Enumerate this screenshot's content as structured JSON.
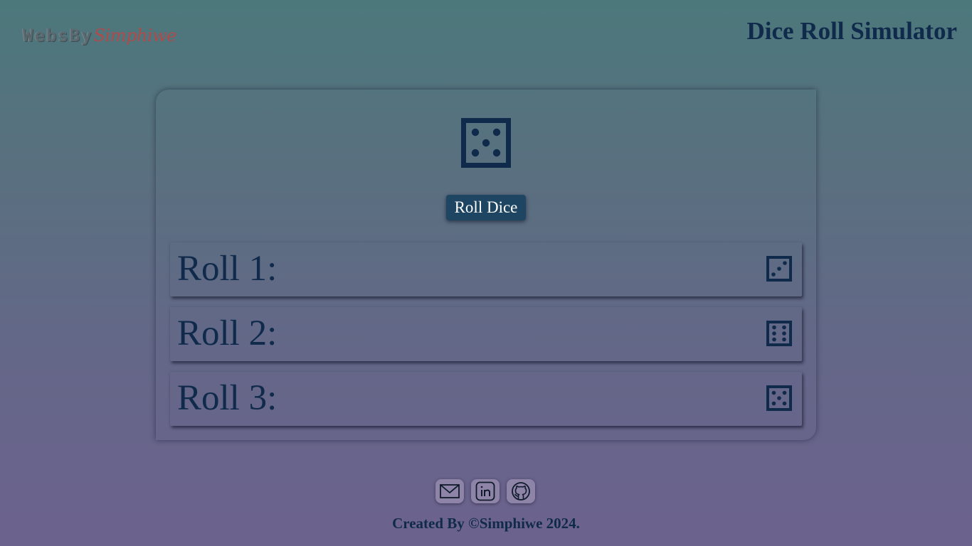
{
  "header": {
    "logo_part1": "WebsBy",
    "logo_part2": "Simphiwe",
    "title": "Dice Roll Simulator"
  },
  "main": {
    "current_die_face": 5,
    "roll_button_label": "Roll Dice"
  },
  "history": [
    {
      "label": "Roll 1:",
      "face": 3
    },
    {
      "label": "Roll 2:",
      "face": 6
    },
    {
      "label": "Roll 3:",
      "face": 5
    }
  ],
  "socials": [
    {
      "icon": "mail-icon"
    },
    {
      "icon": "linkedin-icon"
    },
    {
      "icon": "github-icon"
    }
  ],
  "footer": {
    "text": "Created By ©Simphiwe 2024."
  },
  "colors": {
    "accent": "#1e4562",
    "text": "#0f2a4a",
    "logo_accent": "#b04a4a"
  }
}
